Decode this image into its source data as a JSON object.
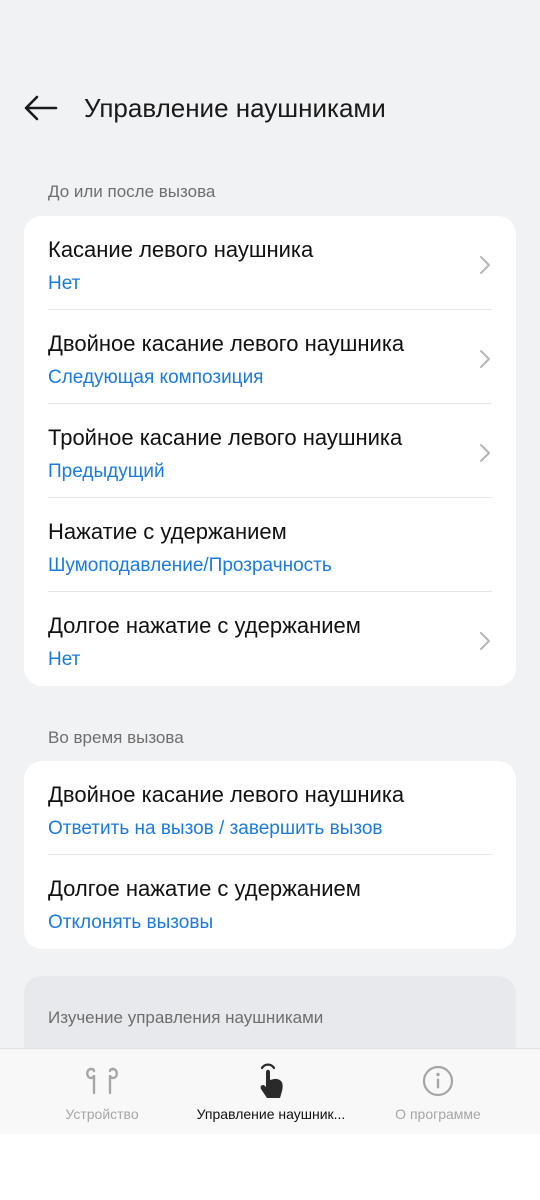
{
  "header": {
    "title": "Управление наушниками",
    "back_icon": "arrow-left-icon"
  },
  "sections": [
    {
      "label": "До или после вызова",
      "items": [
        {
          "label": "Касание левого наушника",
          "value": "Нет",
          "has_chevron": true
        },
        {
          "label": "Двойное касание левого наушника",
          "value": "Следующая композиция",
          "has_chevron": true
        },
        {
          "label": "Тройное касание левого наушника",
          "value": "Предыдущий",
          "has_chevron": true
        },
        {
          "label": "Нажатие с удержанием",
          "value": "Шумоподавление/Прозрачность",
          "has_chevron": false
        },
        {
          "label": "Долгое нажатие с удержанием",
          "value": "Нет",
          "has_chevron": true
        }
      ]
    },
    {
      "label": "Во время вызова",
      "items": [
        {
          "label": "Двойное касание левого наушника",
          "value": "Ответить на вызов / завершить вызов",
          "has_chevron": false
        },
        {
          "label": "Долгое нажатие с удержанием",
          "value": "Отклонять вызовы",
          "has_chevron": false
        }
      ]
    }
  ],
  "learn": {
    "label": "Изучение управления наушниками"
  },
  "bottom_nav": [
    {
      "label": "Устройство",
      "icon": "earbuds-icon",
      "active": false
    },
    {
      "label": "Управление наушник...",
      "icon": "touch-hand-icon",
      "active": true
    },
    {
      "label": "О программе",
      "icon": "info-icon",
      "active": false
    }
  ],
  "colors": {
    "background": "#f1f2f4",
    "card": "#ffffff",
    "accent_value": "#1a7ae0",
    "text_primary": "#111111",
    "text_secondary": "#6e6e6e",
    "nav_inactive": "#a6a6a6"
  }
}
